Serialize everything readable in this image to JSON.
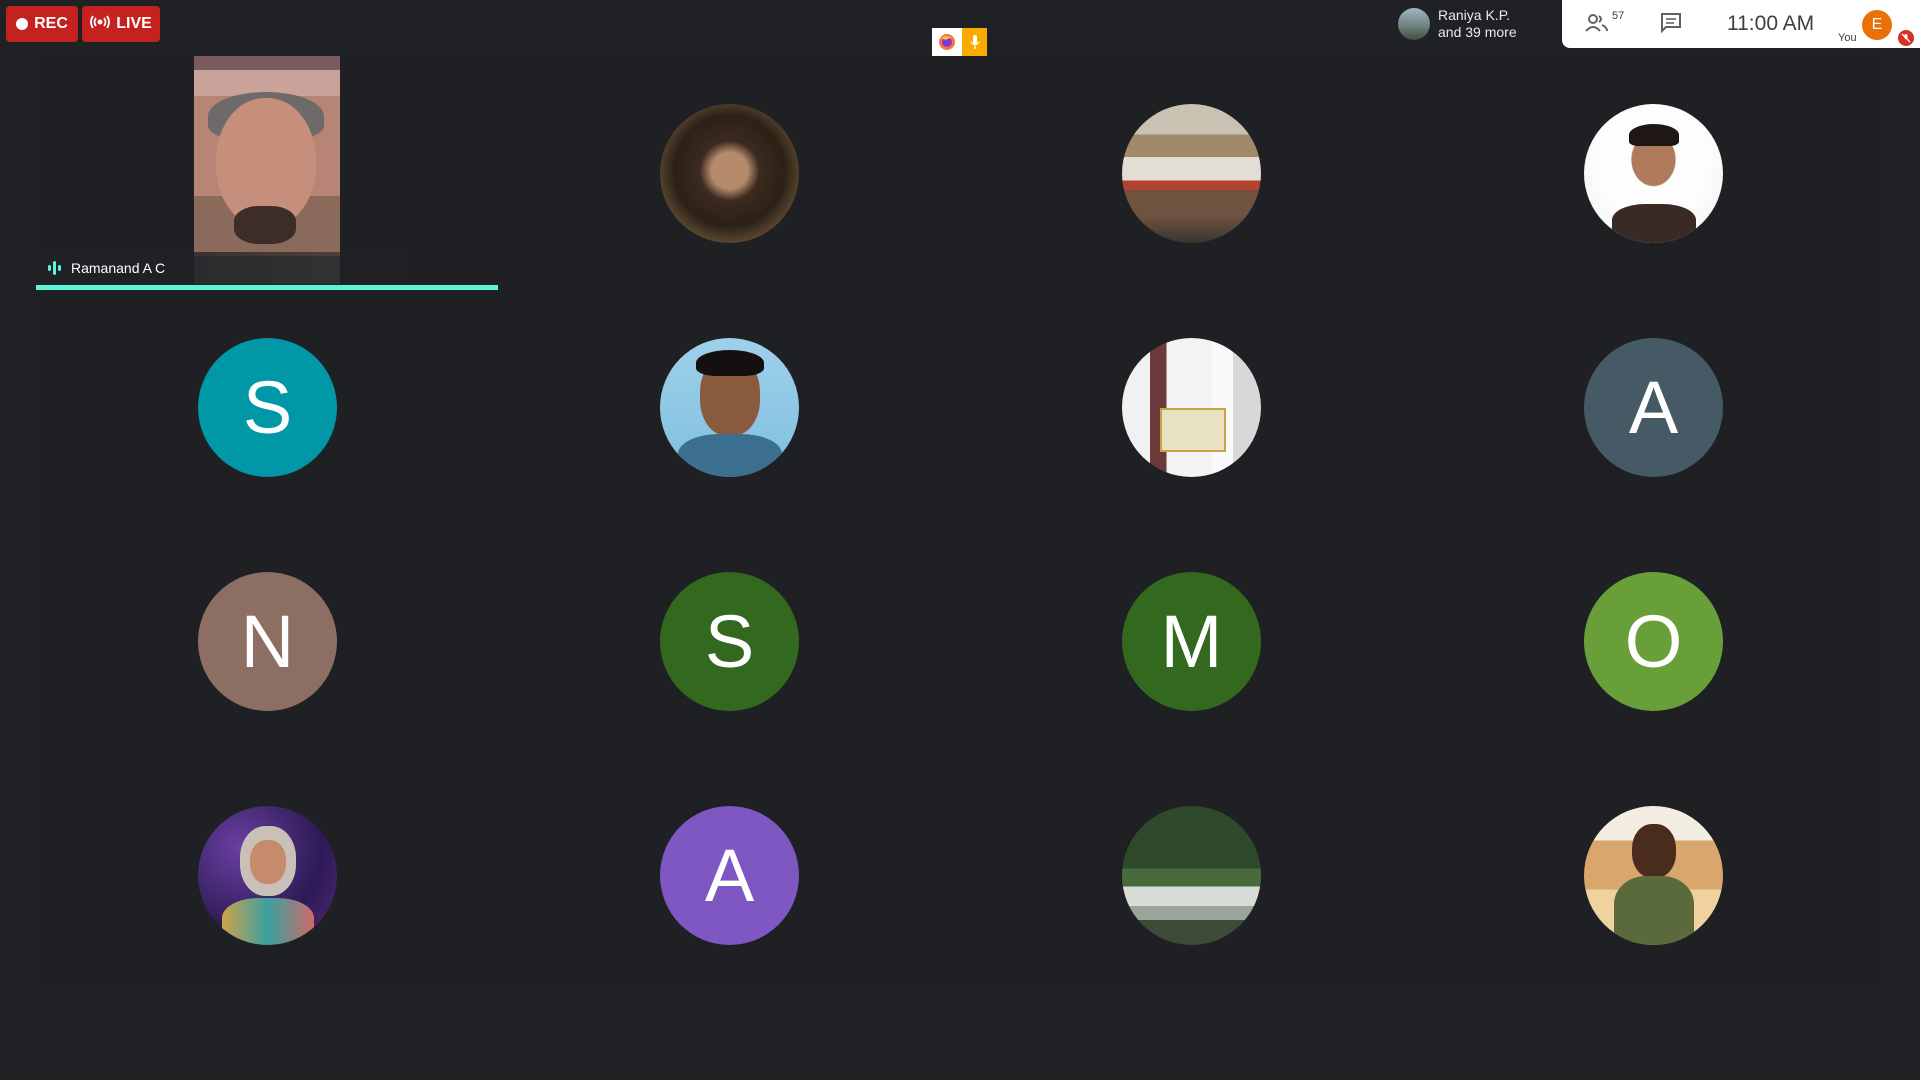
{
  "top_bar": {
    "rec_label": "REC",
    "live_label": "LIVE",
    "presenter": {
      "name": "Raniya K.P.",
      "more": "and 39 more"
    }
  },
  "panel": {
    "people_count": "57",
    "clock": "11:00 AM",
    "self_initial": "E",
    "you_label": "You"
  },
  "tiles": [
    {
      "name": "Ramanand A C",
      "type": "video",
      "speaking": true
    },
    {
      "type": "photo",
      "photo": "portrait-dark"
    },
    {
      "type": "photo",
      "photo": "classroom-presenter"
    },
    {
      "type": "photo",
      "photo": "man-glasses"
    },
    {
      "type": "initial",
      "initial": "S",
      "color": "#0097a7"
    },
    {
      "type": "photo",
      "photo": "young-man-mustache"
    },
    {
      "type": "photo",
      "photo": "certificate-group"
    },
    {
      "type": "initial",
      "initial": "A",
      "color": "#455a64"
    },
    {
      "type": "initial",
      "initial": "N",
      "color": "#8d6e63"
    },
    {
      "type": "initial",
      "initial": "S",
      "color": "#33691e"
    },
    {
      "type": "initial",
      "initial": "M",
      "color": "#33691e"
    },
    {
      "type": "initial",
      "initial": "O",
      "color": "#689f38"
    },
    {
      "type": "photo",
      "photo": "hijab-colorful"
    },
    {
      "type": "initial",
      "initial": "A",
      "color": "#7e57c2"
    },
    {
      "type": "photo",
      "photo": "waterfall-forest"
    },
    {
      "type": "photo",
      "photo": "man-lanyard-event"
    }
  ],
  "colors": {
    "accent_speaking": "#5ff4d6",
    "rec": "#c5221f",
    "background": "#202124"
  }
}
